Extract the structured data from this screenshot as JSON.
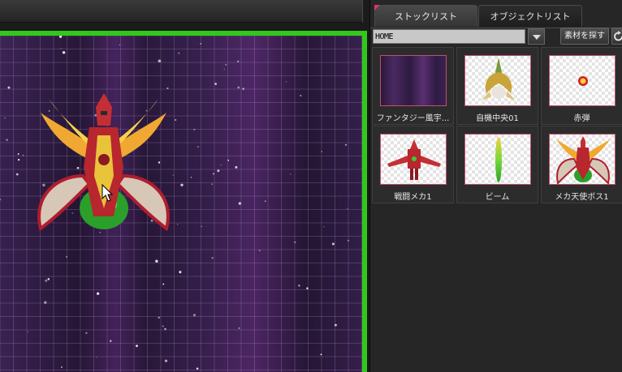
{
  "panel": {
    "tabs": [
      {
        "label": "ストックリスト",
        "active": true
      },
      {
        "label": "オブジェクトリスト",
        "active": false
      }
    ],
    "folder": {
      "value": "HOME"
    },
    "search_button": "素材を探す",
    "assets": [
      {
        "label": "ファンタジー風宇...",
        "icon": "purple-space-background-icon"
      },
      {
        "label": "自機中央01",
        "icon": "player-ship-icon"
      },
      {
        "label": "赤弾",
        "icon": "red-bullet-icon"
      },
      {
        "label": "戦闘メカ1",
        "icon": "battle-mecha-icon"
      },
      {
        "label": "ビーム",
        "icon": "beam-icon"
      },
      {
        "label": "メカ天使ボス1",
        "icon": "mecha-angel-boss-icon"
      }
    ]
  },
  "colors": {
    "stage_border": "#31c81b",
    "space_background": "#3b2252",
    "thumb_border": "#c0506c",
    "tab_marker": "#e0307a"
  }
}
